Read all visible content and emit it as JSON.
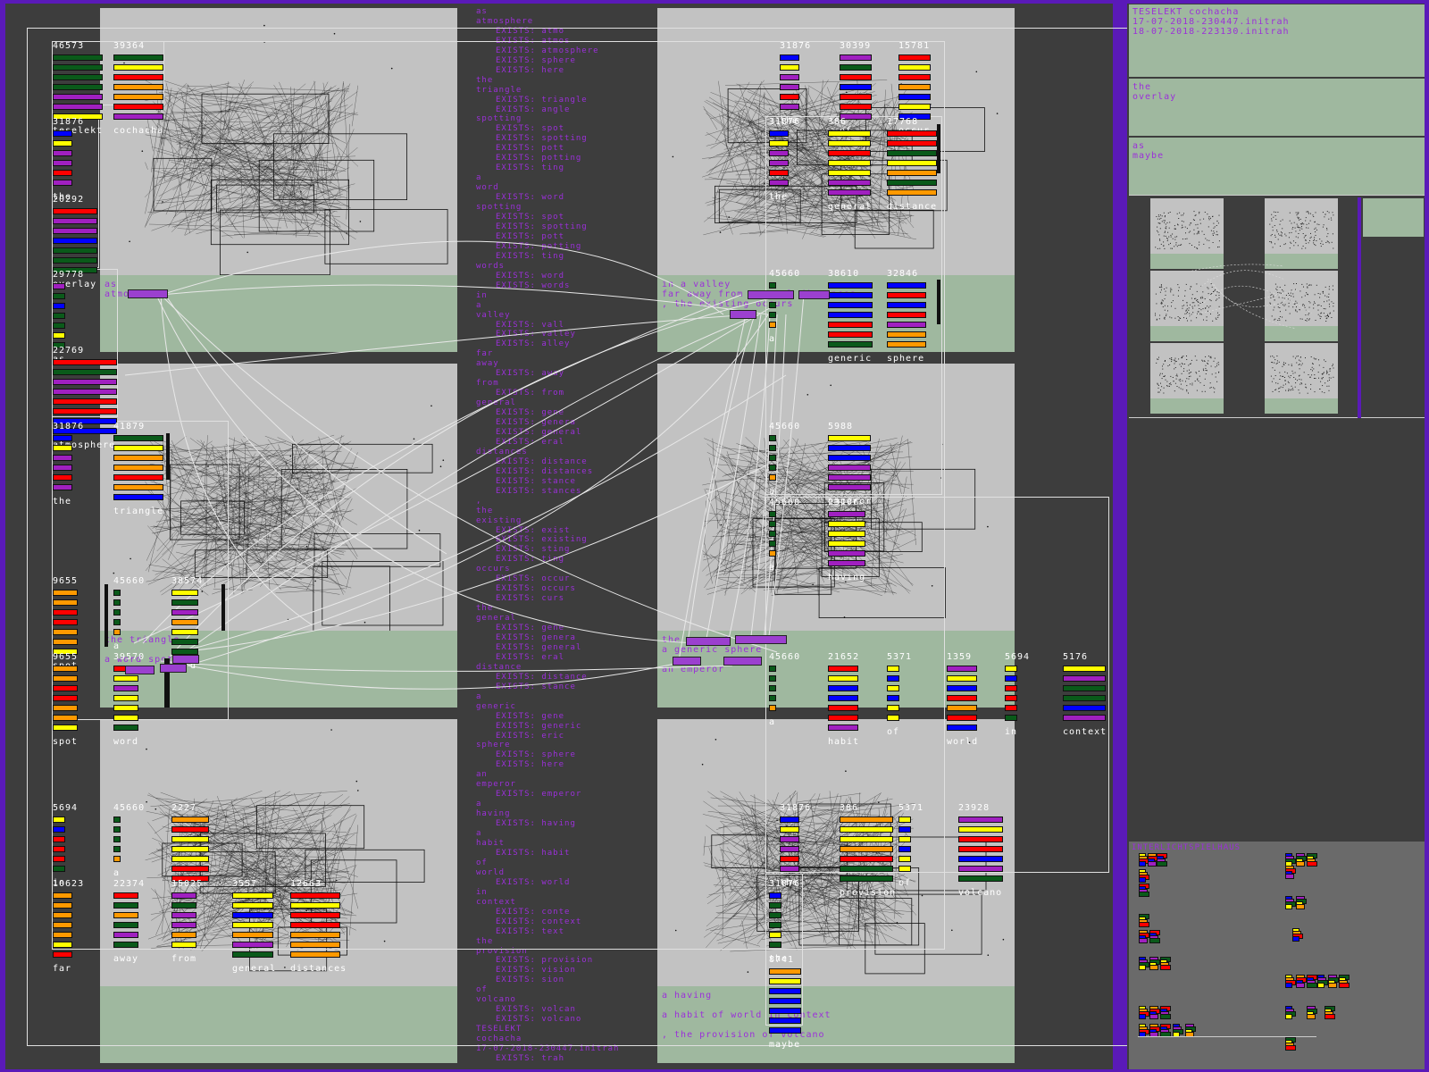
{
  "colors": {
    "background": "#5a1ab8",
    "panel": "#c2c2c2",
    "green_band": "#9fb89f",
    "text_purple": "#9b30d9",
    "stripe_yellow": "#ffff00",
    "stripe_orange": "#ff9900",
    "stripe_red": "#ff0000",
    "stripe_blue": "#0000ff",
    "stripe_purple": "#a020c0",
    "stripe_green": "#0a5a1a"
  },
  "source_column": [
    {
      "w": "as",
      "e": []
    },
    {
      "w": "atmosphere",
      "e": [
        "EXISTS: atmo",
        "EXISTS: atmos",
        "EXISTS: atmosphere",
        "EXISTS: sphere",
        "EXISTS: here"
      ]
    },
    {
      "w": "the",
      "e": []
    },
    {
      "w": "triangle",
      "e": [
        "EXISTS: triangle",
        "EXISTS: angle"
      ]
    },
    {
      "w": "spotting",
      "e": [
        "EXISTS: spot",
        "EXISTS: spotting",
        "EXISTS: pott",
        "EXISTS: potting",
        "EXISTS: ting"
      ]
    },
    {
      "w": "a",
      "e": []
    },
    {
      "w": "word",
      "e": [
        "EXISTS: word"
      ]
    },
    {
      "w": "spotting",
      "e": [
        "EXISTS: spot",
        "EXISTS: spotting",
        "EXISTS: pott",
        "EXISTS: potting",
        "EXISTS: ting"
      ]
    },
    {
      "w": "words",
      "e": [
        "EXISTS: word",
        "EXISTS: words"
      ]
    },
    {
      "w": "in",
      "e": []
    },
    {
      "w": "a",
      "e": []
    },
    {
      "w": "valley",
      "e": [
        "EXISTS: vall",
        "EXISTS: valley",
        "EXISTS: alley"
      ]
    },
    {
      "w": "far",
      "e": []
    },
    {
      "w": "away",
      "e": [
        "EXISTS: away"
      ]
    },
    {
      "w": "from",
      "e": [
        "EXISTS: from"
      ]
    },
    {
      "w": "general",
      "e": [
        "EXISTS: gene",
        "EXISTS: genera",
        "EXISTS: general",
        "EXISTS: eral"
      ]
    },
    {
      "w": "distances",
      "e": [
        "EXISTS: distance",
        "EXISTS: distances",
        "EXISTS: stance",
        "EXISTS: stances"
      ]
    },
    {
      "w": ",",
      "e": []
    },
    {
      "w": "the",
      "e": []
    },
    {
      "w": "existing",
      "e": [
        "EXISTS: exist",
        "EXISTS: existing",
        "EXISTS: sting",
        "EXISTS: ting"
      ]
    },
    {
      "w": "occurs",
      "e": [
        "EXISTS: occur",
        "EXISTS: occurs",
        "EXISTS: curs"
      ]
    },
    {
      "w": "the",
      "e": []
    },
    {
      "w": "general",
      "e": [
        "EXISTS: gene",
        "EXISTS: genera",
        "EXISTS: general",
        "EXISTS: eral"
      ]
    },
    {
      "w": "distance",
      "e": [
        "EXISTS: distance",
        "EXISTS: stance"
      ]
    },
    {
      "w": "a",
      "e": []
    },
    {
      "w": "generic",
      "e": [
        "EXISTS: gene",
        "EXISTS: generic",
        "EXISTS: eric"
      ]
    },
    {
      "w": "sphere",
      "e": [
        "EXISTS: sphere",
        "EXISTS: here"
      ]
    },
    {
      "w": "an",
      "e": []
    },
    {
      "w": "emperor",
      "e": [
        "EXISTS: emperor"
      ]
    },
    {
      "w": "a",
      "e": []
    },
    {
      "w": "having",
      "e": [
        "EXISTS: having"
      ]
    },
    {
      "w": "a",
      "e": []
    },
    {
      "w": "habit",
      "e": [
        "EXISTS: habit"
      ]
    },
    {
      "w": "of",
      "e": []
    },
    {
      "w": "world",
      "e": [
        "EXISTS: world"
      ]
    },
    {
      "w": "in",
      "e": []
    },
    {
      "w": "context",
      "e": [
        "EXISTS: conte",
        "EXISTS: context",
        "EXISTS: text"
      ]
    },
    {
      "w": "the",
      "e": []
    },
    {
      "w": "provision",
      "e": [
        "EXISTS: provision",
        "EXISTS: vision",
        "EXISTS: sion"
      ]
    },
    {
      "w": "of",
      "e": []
    },
    {
      "w": "volcano",
      "e": [
        "EXISTS: volcan",
        "EXISTS: volcano"
      ]
    },
    {
      "w": "TESELEKT",
      "e": []
    },
    {
      "w": "cochacha",
      "e": []
    },
    {
      "w": "17-07-2018-230447.initrah",
      "e": [
        "EXISTS: trah"
      ]
    }
  ],
  "green_texts": {
    "p1": "as\natmosphere",
    "p2": "in a valley\nfar away from general distances\n, the existing occurs",
    "p3": "the triangle\n\na word spotting",
    "p4": "the general distance\na generic sphere\n\nan emperor",
    "p6": "a having\n\na habit of world in context\n\n, the provision of volcano"
  },
  "words": [
    {
      "id": "teselekt",
      "num": "46573",
      "label": "teselekt",
      "colors": [
        "g",
        "g",
        "g",
        "g",
        "p",
        "p",
        "y"
      ]
    },
    {
      "id": "cochacha",
      "num": "39364",
      "label": "cochacha",
      "colors": [
        "g",
        "y",
        "r",
        "o",
        "o",
        "r",
        "p"
      ]
    },
    {
      "id": "the1",
      "num": "31876",
      "label": "the",
      "colors": [
        "b",
        "y",
        "p",
        "p",
        "r",
        "p"
      ]
    },
    {
      "id": "overlay",
      "num": "20292",
      "label": "overlay",
      "colors": [
        "r",
        "p",
        "p",
        "b",
        "g",
        "g",
        "g"
      ]
    },
    {
      "id": "as",
      "num": "29778",
      "label": "as",
      "colors": [
        "p",
        "g",
        "b",
        "g",
        "g",
        "y",
        "g"
      ]
    },
    {
      "id": "atmosphere",
      "num": "22769",
      "label": "atmosphere",
      "colors": [
        "r",
        "g",
        "p",
        "p",
        "r",
        "r",
        "b",
        "b"
      ]
    },
    {
      "id": "the2",
      "num": "31876",
      "label": "the",
      "colors": [
        "b",
        "y",
        "p",
        "p",
        "r",
        "p"
      ]
    },
    {
      "id": "triangle",
      "num": "41879",
      "label": "triangle",
      "colors": [
        "g",
        "y",
        "o",
        "o",
        "r",
        "o",
        "b"
      ]
    },
    {
      "id": "spot1",
      "num": "9655",
      "label": "spot",
      "colors": [
        "o",
        "o",
        "r",
        "r",
        "o",
        "o",
        "y"
      ]
    },
    {
      "id": "a1",
      "num": "45660",
      "label": "a",
      "colors": [
        "g",
        "g",
        "g",
        "g",
        "o"
      ]
    },
    {
      "id": "word1",
      "num": "38574",
      "label": "word",
      "colors": [
        "y",
        "g",
        "p",
        "o",
        "y",
        "g",
        "g"
      ]
    },
    {
      "id": "spot2",
      "num": "9655",
      "label": "spot",
      "colors": [
        "o",
        "o",
        "r",
        "r",
        "o",
        "o",
        "y"
      ]
    },
    {
      "id": "words",
      "num": "39570",
      "label": "word",
      "colors": [
        "r",
        "y",
        "p",
        "y",
        "y",
        "y",
        "g"
      ]
    },
    {
      "id": "in1",
      "num": "5694",
      "label": "in",
      "colors": [
        "y",
        "b",
        "r",
        "r",
        "r",
        "g"
      ]
    },
    {
      "id": "a2",
      "num": "45660",
      "label": "a",
      "colors": [
        "g",
        "g",
        "g",
        "g",
        "o"
      ]
    },
    {
      "id": "having",
      "num": "2227",
      "label": "",
      "colors": [
        "o",
        "r",
        "y",
        "y",
        "y",
        "r",
        "r"
      ]
    },
    {
      "id": "far",
      "num": "10623",
      "label": "far",
      "colors": [
        "o",
        "o",
        "o",
        "o",
        "o",
        "y",
        "r"
      ]
    },
    {
      "id": "away",
      "num": "22374",
      "label": "away",
      "colors": [
        "r",
        "g",
        "o",
        "g",
        "p",
        "g"
      ]
    },
    {
      "id": "from",
      "num": "15025",
      "label": "from",
      "colors": [
        "p",
        "g",
        "p",
        "p",
        "o",
        "y"
      ]
    },
    {
      "id": "general",
      "num": "3557",
      "label": "general",
      "colors": [
        "y",
        "y",
        "b",
        "y",
        "o",
        "p",
        "g"
      ]
    },
    {
      "id": "distances",
      "num": "12663",
      "label": "distances",
      "colors": [
        "r",
        "y",
        "r",
        "r",
        "o",
        "o",
        "o"
      ]
    },
    {
      "id": "the3",
      "num": "31876",
      "label": "the",
      "colors": [
        "b",
        "y",
        "p",
        "p",
        "r",
        "p"
      ]
    },
    {
      "id": "of1",
      "num": "30399",
      "label": "of",
      "colors": [
        "p",
        "g",
        "r",
        "b",
        "r",
        "r",
        "p"
      ]
    },
    {
      "id": "occur",
      "num": "15781",
      "label": "occur",
      "colors": [
        "r",
        "y",
        "r",
        "o",
        "b",
        "y",
        "b"
      ]
    },
    {
      "id": "the4",
      "num": "31876",
      "label": "the",
      "colors": [
        "b",
        "y",
        "p",
        "p",
        "r",
        "p"
      ]
    },
    {
      "id": "general2",
      "num": "386",
      "label": "general",
      "colors": [
        "y",
        "y",
        "r",
        "y",
        "y",
        "p",
        "p"
      ]
    },
    {
      "id": "distance",
      "num": "17768",
      "label": "distance",
      "colors": [
        "r",
        "r",
        "g",
        "y",
        "o",
        "g",
        "o"
      ]
    },
    {
      "id": "a3",
      "num": "45660",
      "label": "a",
      "colors": [
        "g",
        "g",
        "g",
        "g",
        "o"
      ]
    },
    {
      "id": "generic",
      "num": "38610",
      "label": "generic",
      "colors": [
        "b",
        "b",
        "b",
        "b",
        "r",
        "r",
        "g"
      ]
    },
    {
      "id": "sphere",
      "num": "32846",
      "label": "sphere",
      "colors": [
        "b",
        "r",
        "b",
        "r",
        "p",
        "o",
        "o"
      ]
    },
    {
      "id": "a4",
      "num": "45660",
      "label": "a",
      "colors": [
        "g",
        "g",
        "g",
        "g",
        "o"
      ]
    },
    {
      "id": "emperor",
      "num": "5988",
      "label": "emperor",
      "colors": [
        "y",
        "b",
        "b",
        "p",
        "p",
        "p"
      ]
    },
    {
      "id": "a5",
      "num": "45660",
      "label": "a",
      "colors": [
        "g",
        "g",
        "g",
        "g",
        "o"
      ]
    },
    {
      "id": "having2",
      "num": "23106",
      "label": "having",
      "colors": [
        "p",
        "y",
        "y",
        "y",
        "p",
        "p"
      ]
    },
    {
      "id": "a6",
      "num": "45660",
      "label": "a",
      "colors": [
        "g",
        "g",
        "g",
        "g",
        "o"
      ]
    },
    {
      "id": "habit",
      "num": "21652",
      "label": "habit",
      "colors": [
        "r",
        "y",
        "b",
        "b",
        "r",
        "r",
        "p"
      ]
    },
    {
      "id": "of2",
      "num": "5371",
      "label": "of",
      "colors": [
        "y",
        "b",
        "y",
        "b",
        "y",
        "y"
      ]
    },
    {
      "id": "world",
      "num": "1359",
      "label": "world",
      "colors": [
        "p",
        "y",
        "b",
        "r",
        "o",
        "r",
        "b"
      ]
    },
    {
      "id": "in2",
      "num": "5694",
      "label": "in",
      "colors": [
        "y",
        "b",
        "r",
        "r",
        "r",
        "g"
      ]
    },
    {
      "id": "context",
      "num": "5176",
      "label": "context",
      "colors": [
        "y",
        "p",
        "g",
        "g",
        "b",
        "p"
      ]
    },
    {
      "id": "the5",
      "num": "31876",
      "label": "the",
      "colors": [
        "b",
        "y",
        "p",
        "p",
        "r",
        "p"
      ]
    },
    {
      "id": "provision",
      "num": "386",
      "label": "provision",
      "colors": [
        "o",
        "y",
        "y",
        "o",
        "r",
        "g",
        "g"
      ]
    },
    {
      "id": "of3",
      "num": "5371",
      "label": "of",
      "colors": [
        "y",
        "b",
        "y",
        "b",
        "y",
        "y"
      ]
    },
    {
      "id": "volcano",
      "num": "23928",
      "label": "volcano",
      "colors": [
        "p",
        "y",
        "r",
        "r",
        "b",
        "p",
        "g"
      ]
    },
    {
      "id": "the6",
      "num": "31876",
      "label": "the",
      "colors": [
        "b",
        "g",
        "g",
        "g",
        "y",
        "g"
      ]
    },
    {
      "id": "maybe",
      "num": "8741",
      "label": "maybe",
      "colors": [
        "o",
        "y",
        "b",
        "b",
        "b",
        "b",
        "b"
      ]
    }
  ],
  "right": {
    "header_lines": "TESELEKT cochacha\n17-07-2018-230447.initrah\n18-07-2018-223130.initrah",
    "box2": "the\noverlay",
    "box3": "as\nmaybe",
    "bottom_title": "INTERLICHTSPIELHAUS"
  }
}
